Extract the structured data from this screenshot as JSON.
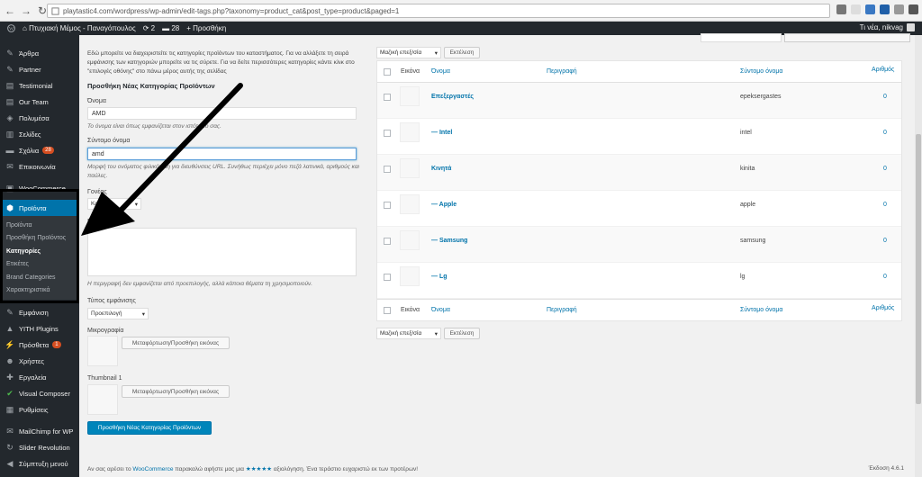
{
  "browser": {
    "url": "playtastic4.com/wordpress/wp-admin/edit-tags.php?taxonomy=product_cat&post_type=product&paged=1"
  },
  "adminbar": {
    "site_name": "Πτυχιακή Μέμος - Παναγόπουλος",
    "updates_count": "2",
    "comments_count": "28",
    "new_label": "+ Προσθήκη",
    "howdy": "Τι νέα, nikvag"
  },
  "sidebar": {
    "items": [
      {
        "label": "Άρθρα",
        "icon": "pin-icon"
      },
      {
        "label": "Partner",
        "icon": "partner-icon"
      },
      {
        "label": "Testimonial",
        "icon": "testimonial-icon"
      },
      {
        "label": "Our Team",
        "icon": "team-icon"
      },
      {
        "label": "Πολυμέσα",
        "icon": "media-icon"
      },
      {
        "label": "Σελίδες",
        "icon": "pages-icon"
      },
      {
        "label": "Σχόλια",
        "icon": "comments-icon",
        "badge": "28"
      },
      {
        "label": "Επικοινωνία",
        "icon": "mail-icon"
      },
      {
        "label": "WooCommerce",
        "icon": "woo-icon"
      }
    ],
    "active": {
      "label": "Προϊόντα",
      "icon": "products-icon"
    },
    "submenu": [
      "Προϊόντα",
      "Προσθήκη Προϊόντος",
      "Κατηγορίες",
      "Ετικέτες",
      "Brand Categories",
      "Χαρακτηριστικά"
    ],
    "items_after": [
      {
        "label": "Εμφάνιση",
        "icon": "appearance-icon"
      },
      {
        "label": "YITH Plugins",
        "icon": "yith-icon"
      },
      {
        "label": "Πρόσθετα",
        "icon": "plugins-icon",
        "badge": "1"
      },
      {
        "label": "Χρήστες",
        "icon": "users-icon"
      },
      {
        "label": "Εργαλεία",
        "icon": "tools-icon"
      },
      {
        "label": "Visual Composer",
        "icon": "vc-icon"
      },
      {
        "label": "Ρυθμίσεις",
        "icon": "settings-icon"
      },
      {
        "label": "MailChimp for WP",
        "icon": "mailchimp-icon"
      },
      {
        "label": "Slider Revolution",
        "icon": "slider-icon"
      },
      {
        "label": "Σύμπτυξη μενού",
        "icon": "collapse-icon"
      }
    ]
  },
  "form": {
    "intro": "Εδώ μπορείτε να διαχειριστείτε τις κατηγορίες προϊόντων του καταστήματος. Για να αλλάξετε τη σειρά εμφάνισης των κατηγοριών μπορείτε να τις σύρετε. Για να δείτε περισσότερες κατηγορίες κάντε κλικ στο \"επιλογές οθόνης\" στο πάνω μέρος αυτής της σελίδας",
    "title": "Προσθήκη Νέας Κατηγορίας Προϊόντων",
    "name_label": "Όνομα",
    "name_value": "AMD",
    "name_hint": "Το όνομα είναι όπως εμφανίζεται στον ιστότοπό σας.",
    "slug_label": "Σύντομο όνομα",
    "slug_value": "amd",
    "slug_hint": "Μορφή του ονόματος φιλικότερη για διευθύνσεις URL. Συνήθως περιέχει μόνο πεζά λατινικά, αριθμούς και παύλες.",
    "parent_label": "Γονέας",
    "parent_value": "Κανένα",
    "description_label": "Περιγραφή",
    "description_hint": "Η περιγραφή δεν εμφανίζεται από προεπιλογής, αλλά κάποια θέματα τη χρησιμοποιούν.",
    "display_type_label": "Τύπος εμφάνισης",
    "display_type_value": "Προεπιλογή",
    "thumbnail_label": "Μικρογραφία",
    "upload_button": "Μεταφόρτωση/Προσθήκη εικόνας",
    "thumbnail1_label": "Thumbnail 1",
    "upload_button_2": "Μεταφόρτωση/Προσθήκη εικόνας",
    "submit": "Προσθήκη Νέας Κατηγορίας Προϊόντων"
  },
  "table": {
    "bulk_select": "Μαζική επεξ/σία",
    "apply_button": "Εκτέλεση",
    "columns": {
      "image": "Εικόνα",
      "name": "Όνομα",
      "description": "Περιγραφή",
      "slug": "Σύντομο όνομα",
      "count": "Αριθμός"
    },
    "rows": [
      {
        "name": "Επεξεργαστές",
        "description": "",
        "slug": "epeksergastes",
        "count": "0"
      },
      {
        "name": "— Intel",
        "description": "",
        "slug": "intel",
        "count": "0"
      },
      {
        "name": "Κινητά",
        "description": "",
        "slug": "kinita",
        "count": "0"
      },
      {
        "name": "— Apple",
        "description": "",
        "slug": "apple",
        "count": "0"
      },
      {
        "name": "— Samsung",
        "description": "",
        "slug": "samsung",
        "count": "0"
      },
      {
        "name": "— Lg",
        "description": "",
        "slug": "lg",
        "count": "0"
      }
    ]
  },
  "footer": {
    "text_before": "Αν σας αρέσει το ",
    "woo": "WooCommerce",
    "text_mid": " παρακαλώ αφήστε μας μια ",
    "stars": "★★★★★",
    "text_after": " αξιολόγηση. Ένα τεράστιο ευχαριστώ εκ των προτέρων!",
    "version": "Έκδοση 4.6.1"
  },
  "colors": {
    "admin_dark": "#23282d",
    "accent_blue": "#0073aa",
    "primary_button": "#0085ba",
    "badge": "#d54e21",
    "annotation_black": "#000000"
  }
}
